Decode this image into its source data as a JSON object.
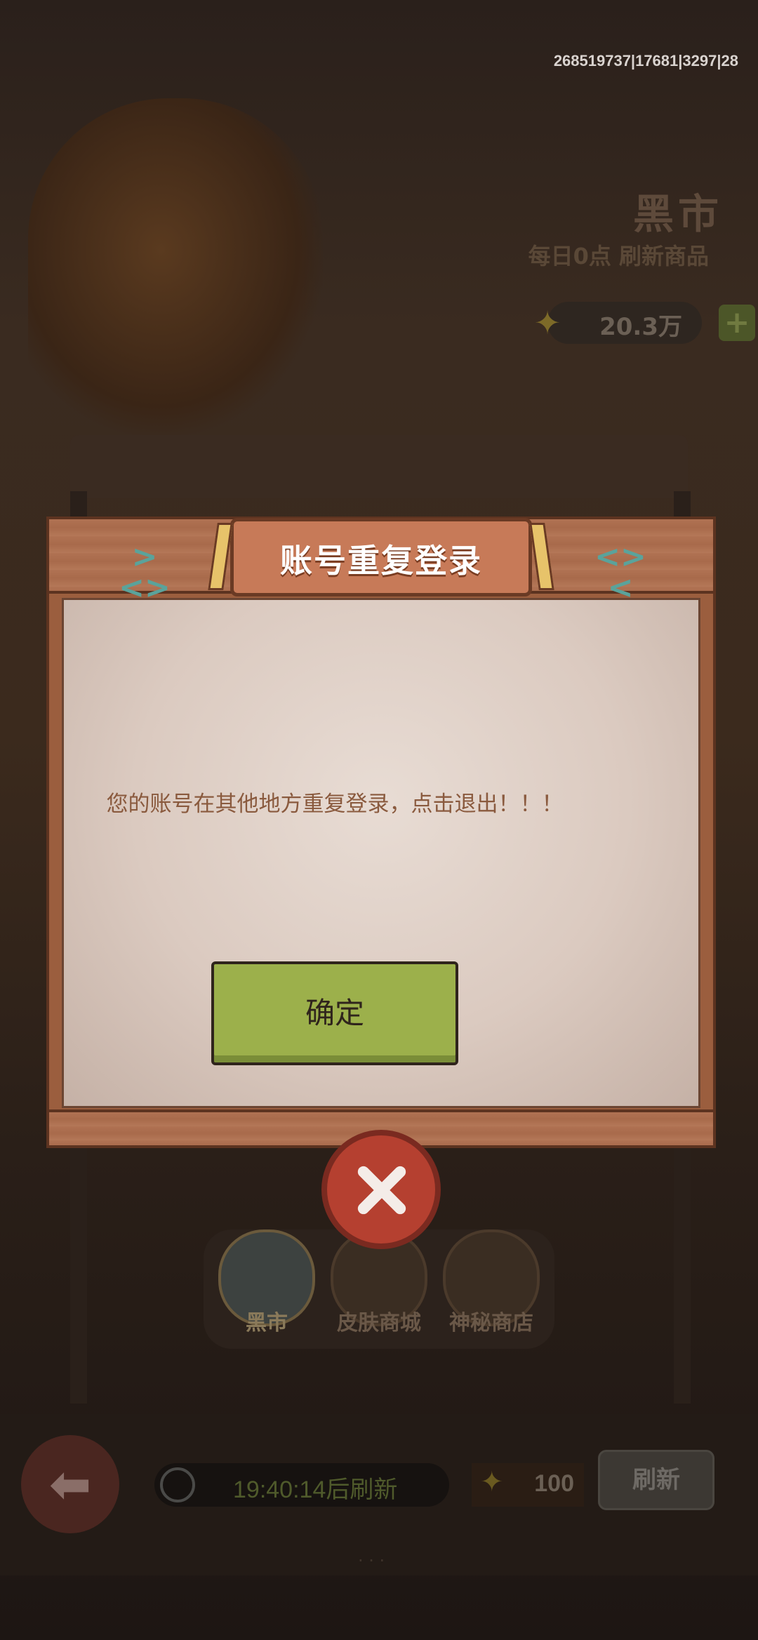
{
  "debug": {
    "text": "268519737|17681|3297|28"
  },
  "header": {
    "title": "黑市",
    "refresh_note": "每日0点 刷新商品",
    "currency_value": "20.3万"
  },
  "tabs": [
    {
      "label": "黑市",
      "active": true
    },
    {
      "label": "皮肤商城",
      "active": false
    },
    {
      "label": "神秘商店",
      "active": false
    }
  ],
  "bottom_bar": {
    "timer": "19:40:14后刷新",
    "coin_value": "100",
    "refresh_label": "刷新"
  },
  "dialog": {
    "title": "账号重复登录",
    "message": "您的账号在其他地方重复登录，点击退出！！！",
    "ok_label": "确定"
  },
  "colors": {
    "dialog_frame": "#9b5e3e",
    "title_plate": "#c77a58",
    "ok_button": "#9cb04b",
    "close_button": "#b54030",
    "message_text": "#8a5a3e"
  },
  "icons": [
    "fish-icon",
    "close-icon",
    "back-arrow-icon",
    "clock-icon",
    "bone-coin-icon",
    "plus-icon"
  ]
}
